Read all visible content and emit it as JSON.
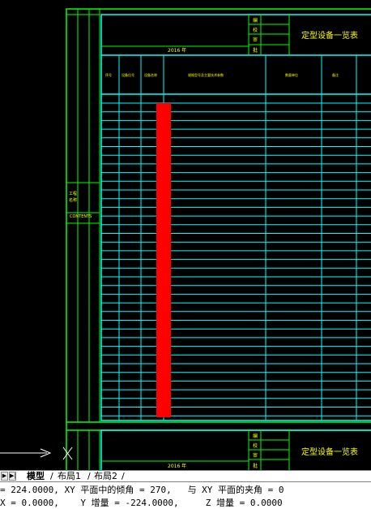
{
  "drawing": {
    "title": "定型设备一览表",
    "year_label": "2016 年",
    "header_columns": [
      "序号",
      "设备位号",
      "设备名称",
      "规格型号及主要技术参数",
      "数量单位",
      "备注"
    ],
    "sign_labels": [
      "编",
      "校",
      "审",
      "批"
    ],
    "side_stamp_lines": [
      "工程",
      "名称"
    ],
    "side_stamp_label": "CONTENTS",
    "bottom_title": "定型设备一览表",
    "bottom_year_label": "2016 年",
    "bottom_sign_labels": [
      "编",
      "校",
      "审",
      "批"
    ],
    "colors": {
      "background": "#000000",
      "frame_green": "#00ff00",
      "table_cyan": "#00ffff",
      "text_yellow": "#ffff00",
      "highlight_red": "#ff0000"
    }
  },
  "tabs": {
    "items": [
      "模型",
      "布局1",
      "布局2"
    ],
    "active": "模型"
  },
  "command_line": {
    "line1": "= 224.0000, XY 平面中的倾角 = 270,   与 XY 平面的夹角 = 0",
    "line2": "X = 0.0000,    Y 增量 = -224.0000,     Z 增量 = 0.0000"
  }
}
